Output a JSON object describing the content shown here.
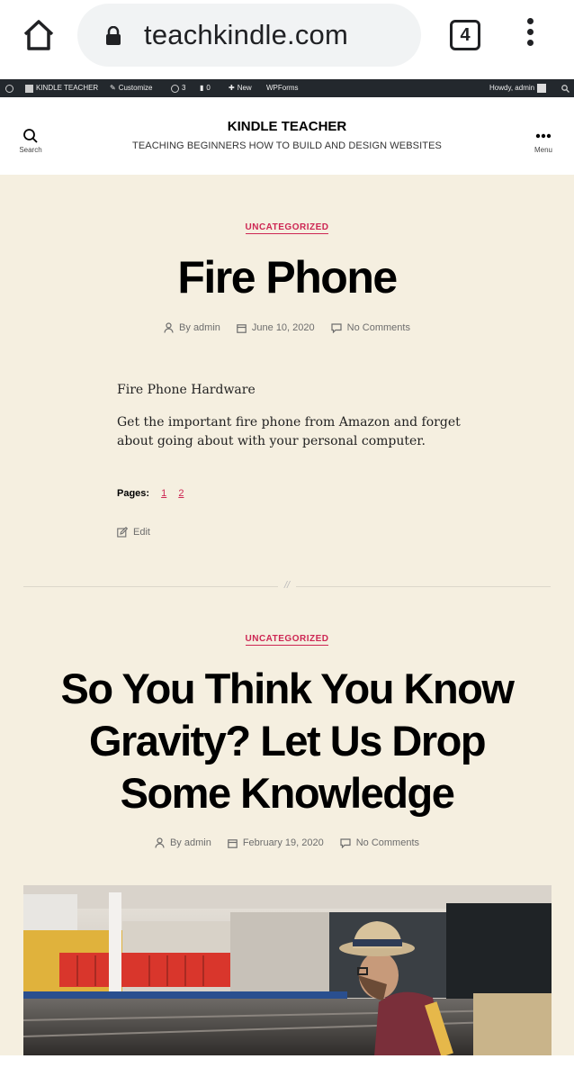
{
  "browser": {
    "url": "teachkindle.com",
    "tab_count": "4"
  },
  "admin_bar": {
    "site_name": "KINDLE TEACHER",
    "customize": "Customize",
    "updates_count": "3",
    "comments_count": "0",
    "new_label": "New",
    "wpforms": "WPForms",
    "howdy": "Howdy, admin"
  },
  "site": {
    "title": "KINDLE TEACHER",
    "description": "TEACHING BEGINNERS HOW TO BUILD AND DESIGN WEBSITES",
    "search_label": "Search",
    "menu_label": "Menu"
  },
  "posts": [
    {
      "category": "UNCATEGORIZED",
      "title": "Fire Phone",
      "author": "By admin",
      "date": "June 10, 2020",
      "comments": "No Comments",
      "paragraphs": [
        "Fire Phone Hardware",
        "Get the important fire phone from Amazon and forget about going about with your personal computer."
      ],
      "pages_label": "Pages:",
      "page_links": [
        "1",
        "2"
      ],
      "edit_label": "Edit"
    },
    {
      "category": "UNCATEGORIZED",
      "title_lines": [
        "So You Think You Know",
        "Gravity? Let Us Drop",
        "Some Knowledge"
      ],
      "author": "By admin",
      "date": "February 19, 2020",
      "comments": "No Comments"
    }
  ],
  "separator": "//",
  "colors": {
    "accent": "#cd2653",
    "background": "#f5efe0",
    "admin_bar": "#23282d"
  }
}
